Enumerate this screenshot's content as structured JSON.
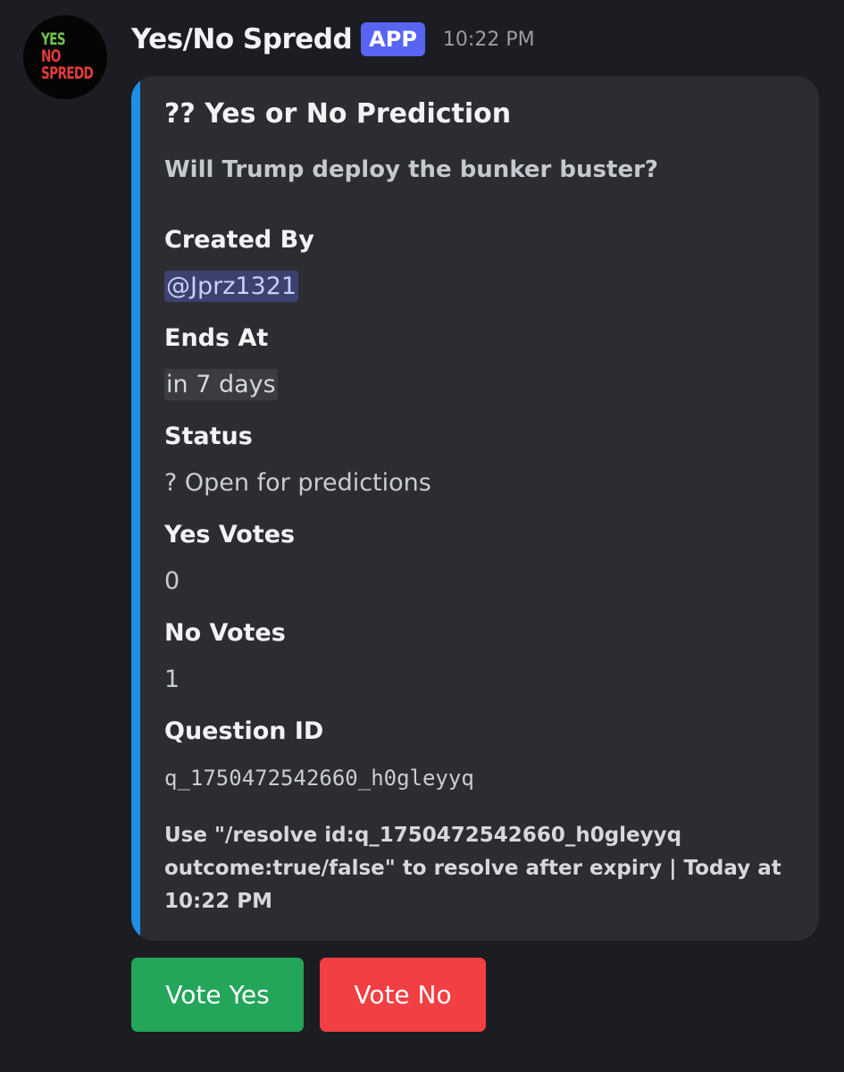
{
  "avatar": {
    "logo_lines": [
      "YES",
      "NO",
      "SPREDD"
    ],
    "colors": {
      "yes": "#6fc24a",
      "no": "#e23b3b",
      "background": "#050505"
    }
  },
  "header": {
    "username": "Yes/No Spredd",
    "badge": "APP",
    "timestamp": "10:22 PM"
  },
  "embed": {
    "accent_color": "#1d8fe6",
    "title": "?? Yes or No Prediction",
    "description": "Will Trump deploy the bunker buster?",
    "fields": {
      "created_by": {
        "name": "Created By",
        "value": "@Jprz1321"
      },
      "ends_at": {
        "name": "Ends At",
        "value": "in 7 days"
      },
      "status": {
        "name": "Status",
        "value": "? Open for predictions"
      },
      "yes_votes": {
        "name": "Yes Votes",
        "value": "0"
      },
      "no_votes": {
        "name": "No Votes",
        "value": "1"
      },
      "question_id": {
        "name": "Question ID",
        "value": "q_1750472542660_h0gleyyq"
      }
    },
    "footer": "Use \"/resolve id:q_1750472542660_h0gleyyq outcome:true/false\" to resolve after expiry | Today at 10:22 PM"
  },
  "buttons": {
    "yes": {
      "label": "Vote Yes",
      "color": "#23a55a"
    },
    "no": {
      "label": "Vote No",
      "color": "#f23f43"
    }
  }
}
